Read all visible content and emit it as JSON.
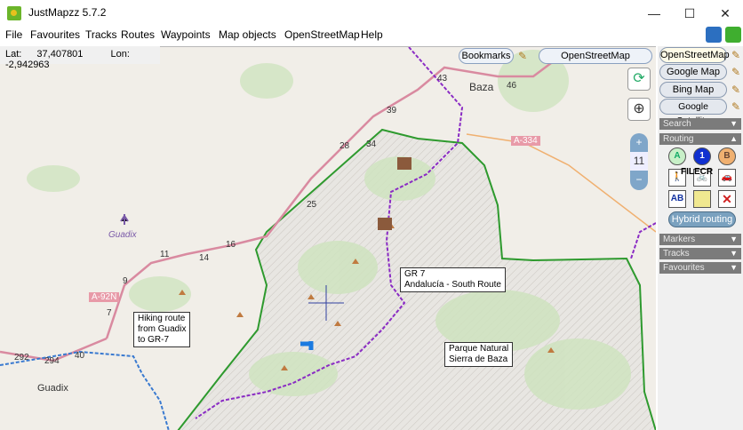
{
  "window": {
    "title": "JustMapzz 5.7.2",
    "minimize": "—",
    "maximize": "☐",
    "close": "✕"
  },
  "menu": [
    "File",
    "Favourites",
    "Tracks",
    "Routes",
    "Waypoints",
    "Map objects",
    "OpenStreetMap",
    "Help"
  ],
  "coords": {
    "lat_label": "Lat:",
    "lat": "37,407801",
    "lon_label": "Lon:",
    "lon": "-2,942963"
  },
  "map_toolbar": {
    "bookmarks": "Bookmarks",
    "layer": "OpenStreetMap"
  },
  "zoom": {
    "plus": "+",
    "level": "11",
    "minus": "−"
  },
  "map": {
    "places": [
      "Baza",
      "Guadix",
      "Guadix"
    ],
    "roads": [
      "A-334",
      "A-92N",
      "43",
      "46",
      "39",
      "34",
      "28",
      "25",
      "16",
      "14",
      "11",
      "9",
      "7",
      "292",
      "294",
      "40"
    ],
    "callouts": {
      "gr7": [
        "GR 7",
        "Andalucía - South Route"
      ],
      "hiking": [
        "Hiking route",
        "from Guadix",
        "to GR-7"
      ],
      "park": [
        "Parque Natural",
        "Sierra de Baza"
      ]
    },
    "colors": {
      "park_border": "#2e9a2e",
      "route_gr7": "#8a2bc4",
      "route_hiking": "#3a7ad0",
      "roads": "#d98aa0",
      "forest": "#cfe3bf"
    }
  },
  "panel": {
    "maps": [
      "OpenStreetMap",
      "Google Map",
      "Bing Map",
      "Google Satellite"
    ],
    "active_map": "OpenStreetMap",
    "sections": {
      "search": "Search",
      "routing": "Routing",
      "markers": "Markers",
      "tracks": "Tracks",
      "favourites": "Favourites"
    },
    "routing_buttons": [
      "A",
      "1",
      "B",
      "walk",
      "bike",
      "car",
      "AB",
      "map",
      "✕"
    ],
    "watermark": "FILECR",
    "hybrid": "Hybrid routing"
  }
}
